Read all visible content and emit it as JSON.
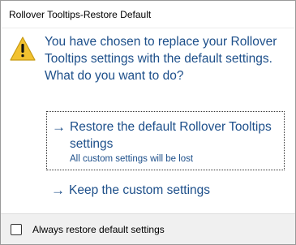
{
  "window": {
    "title": "Rollover Tooltips-Restore Default"
  },
  "dialog": {
    "icon": "warning-icon",
    "instruction": "You have chosen to replace your Rollover Tooltips settings with the default settings. What do you want to do?"
  },
  "commands": [
    {
      "label": "Restore the default Rollover Tooltips settings",
      "note": "All custom settings will be lost",
      "focused": true
    },
    {
      "label": "Keep the custom settings",
      "focused": false
    }
  ],
  "footer": {
    "checkbox_label": "Always restore default settings",
    "checked": false
  },
  "colors": {
    "instruction_text": "#1d4f8a",
    "warning": "#f2c230"
  }
}
